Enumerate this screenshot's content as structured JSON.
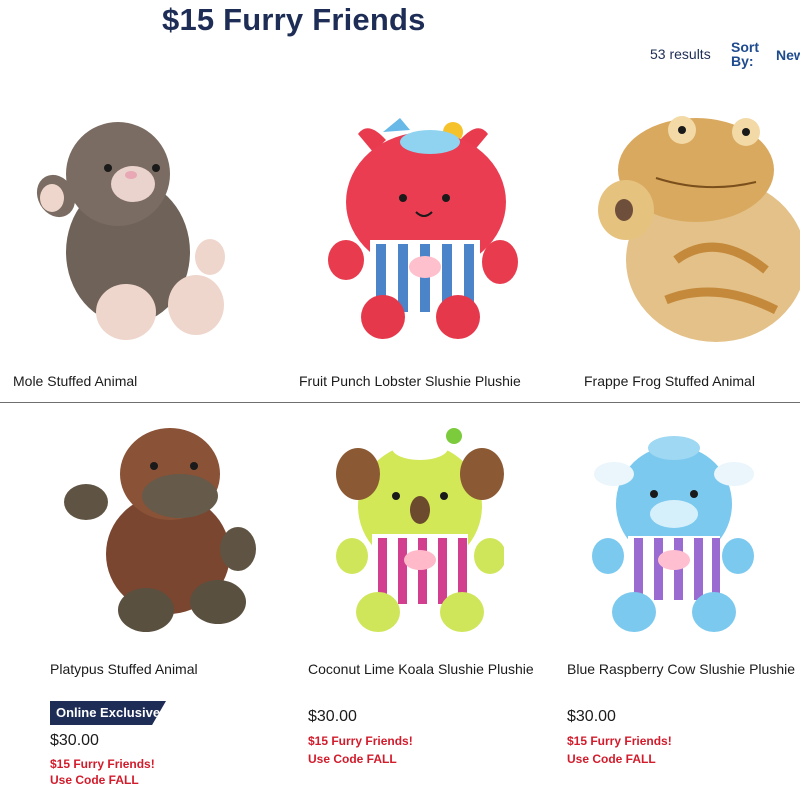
{
  "header": {
    "title": "$15 Furry Friends",
    "results": "53 results",
    "sort_label": "Sort By:",
    "sort_value": "Newest"
  },
  "products": [
    {
      "name": "Mole Stuffed Animal"
    },
    {
      "name": "Fruit Punch Lobster Slushie Plushie"
    },
    {
      "name": "Frappe Frog Stuffed Animal"
    },
    {
      "name": "Platypus Stuffed Animal",
      "badge": "Online Exclusive",
      "price": "$30.00",
      "promo": "$15 Furry Friends!",
      "code": "Use Code FALL"
    },
    {
      "name": "Coconut Lime Koala Slushie Plushie",
      "price": "$30.00",
      "promo": "$15 Furry Friends!",
      "code": "Use Code FALL"
    },
    {
      "name": "Blue Raspberry Cow Slushie Plushie",
      "price": "$30.00",
      "promo": "$15 Furry Friends!",
      "code": "Use Code FALL"
    }
  ],
  "colors": {
    "brand_navy": "#1e2d56",
    "promo_red": "#d21c2c",
    "link_blue": "#1e4b8f"
  }
}
